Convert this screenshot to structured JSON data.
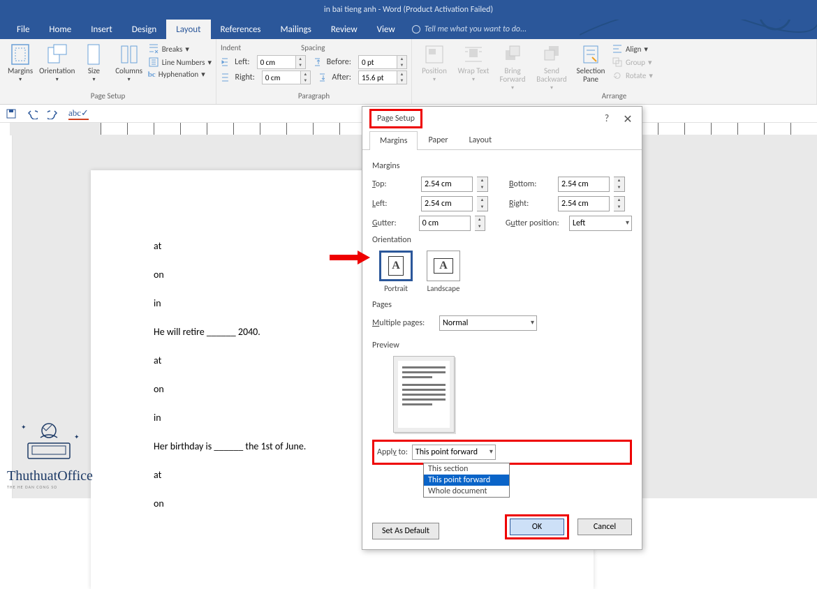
{
  "title": "in bai tieng anh - Word (Product Activation Failed)",
  "tabs": [
    "File",
    "Home",
    "Insert",
    "Design",
    "Layout",
    "References",
    "Mailings",
    "Review",
    "View"
  ],
  "tell_me": "Tell me what you want to do...",
  "ribbon": {
    "page_setup": {
      "label": "Page Setup",
      "margins": "Margins",
      "orientation": "Orientation",
      "size": "Size",
      "columns": "Columns",
      "breaks": "Breaks",
      "line_numbers": "Line Numbers",
      "hyphenation": "Hyphenation"
    },
    "paragraph": {
      "label": "Paragraph",
      "indent": "Indent",
      "spacing": "Spacing",
      "left": "Left:",
      "right": "Right:",
      "before": "Before:",
      "after": "After:",
      "left_val": "0 cm",
      "right_val": "0 cm",
      "before_val": "0 pt",
      "after_val": "15.6 pt"
    },
    "arrange": {
      "label": "Arrange",
      "position": "Position",
      "wrap": "Wrap Text",
      "bring": "Bring Forward",
      "send": "Send Backward",
      "selpane": "Selection Pane",
      "align": "Align",
      "group": "Group",
      "rotate": "Rotate"
    }
  },
  "doc_lines": [
    "at",
    "on",
    "in",
    "He will retire ______ 2040.",
    "at",
    "on",
    "in",
    "Her birthday is ______ the 1st of June.",
    "at",
    "on"
  ],
  "dialog": {
    "title": "Page Setup",
    "tabs": [
      "Margins",
      "Paper",
      "Layout"
    ],
    "sec_margins": "Margins",
    "top": "Top:",
    "bottom": "Bottom:",
    "left": "Left:",
    "right": "Right:",
    "gutter": "Gutter:",
    "gutter_pos": "Gutter position:",
    "top_v": "2.54 cm",
    "bottom_v": "2.54 cm",
    "left_v": "2.54 cm",
    "right_v": "2.54 cm",
    "gutter_v": "0 cm",
    "gutter_pos_v": "Left",
    "sec_orient": "Orientation",
    "portrait": "Portrait",
    "landscape": "Landscape",
    "sec_pages": "Pages",
    "multi": "Multiple pages:",
    "multi_v": "Normal",
    "sec_preview": "Preview",
    "apply_to": "Apply to:",
    "apply_v": "This point forward",
    "apply_opts": [
      "This section",
      "This point forward",
      "Whole document"
    ],
    "set_default": "Set As Default",
    "ok": "OK",
    "cancel": "Cancel"
  },
  "watermark": {
    "name": "ThuthuatOffice",
    "sub": "THE HE DAN CONG SO"
  }
}
